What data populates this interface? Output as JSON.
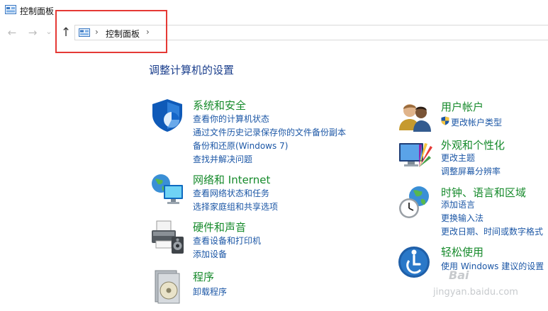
{
  "window": {
    "title": "控制面板"
  },
  "nav": {
    "back": "←",
    "forward": "→",
    "dropdown": "⌄",
    "up": "↑",
    "separator": "›"
  },
  "address": {
    "crumb": "控制面板"
  },
  "page": {
    "title": "调整计算机的设置"
  },
  "categories": {
    "system": {
      "title": "系统和安全",
      "links": [
        "查看你的计算机状态",
        "通过文件历史记录保存你的文件备份副本",
        "备份和还原(Windows 7)",
        "查找并解决问题"
      ]
    },
    "network": {
      "title": "网络和 Internet",
      "links": [
        "查看网络状态和任务",
        "选择家庭组和共享选项"
      ]
    },
    "hardware": {
      "title": "硬件和声音",
      "links": [
        "查看设备和打印机",
        "添加设备"
      ]
    },
    "programs": {
      "title": "程序",
      "links": [
        "卸载程序"
      ]
    },
    "user": {
      "title": "用户帐户",
      "links": [
        "更改帐户类型"
      ]
    },
    "appearance": {
      "title": "外观和个性化",
      "links": [
        "更改主题",
        "调整屏幕分辨率"
      ]
    },
    "clock": {
      "title": "时钟、语言和区域",
      "links": [
        "添加语言",
        "更换输入法",
        "更改日期、时间或数字格式"
      ]
    },
    "ease": {
      "title": "轻松使用",
      "links": [
        "使用 Windows 建议的设置"
      ]
    }
  },
  "watermark": {
    "top": "Bai",
    "bottom": "jingyan.baidu.com"
  },
  "colors": {
    "link": "#1c57a6",
    "category": "#168a2b",
    "highlight": "#e53935",
    "heading": "#1a3e8c"
  }
}
